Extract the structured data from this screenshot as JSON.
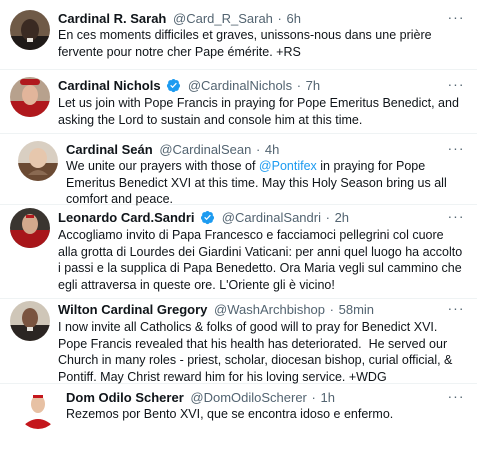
{
  "tweets": [
    {
      "name": "Cardinal R. Sarah",
      "handle": "@Card_R_Sarah",
      "dot": "·",
      "time": "6h",
      "verified": false,
      "text": "En ces moments difficiles et graves, unissons-nous dans une prière fervente pour notre cher Pape émérite. +RS"
    },
    {
      "name": "Cardinal Nichols",
      "handle": "@CardinalNichols",
      "dot": "·",
      "time": "7h",
      "verified": true,
      "text": "Let us join with Pope Francis in praying for Pope Emeritus Benedict, and asking the Lord to sustain and console him at this time."
    },
    {
      "name": "Cardinal Seán",
      "handle": "@CardinalSean",
      "dot": "·",
      "time": "4h",
      "verified": false,
      "text_before": "We unite our prayers with those of ",
      "mention": "@Pontifex",
      "text_after": " in praying for Pope Emeritus Benedict XVI at this time. May this Holy Season bring us all comfort and peace."
    },
    {
      "name": "Leonardo Card.Sandri",
      "handle": "@CardinalSandri",
      "dot": "·",
      "time": "2h",
      "verified": true,
      "text": "Accogliamo invito di Papa Francesco e facciamoci pellegrini col cuore alla grotta di Lourdes dei Giardini Vaticani: per anni quel luogo ha accolto i passi e la supplica di Papa Benedetto. Ora Maria vegli sul cammino che egli attraversa in queste ore. L'Oriente gli è vicino!"
    },
    {
      "name": "Wilton Cardinal Gregory",
      "handle": "@WashArchbishop",
      "dot": "·",
      "time": "58min",
      "verified": false,
      "text": "I now invite all Catholics & folks of good will to pray for Benedict XVI. Pope Francis revealed that his health has deteriorated.  He served our Church in many roles - priest, scholar, diocesan bishop, curial official, & Pontiff. May Christ reward him for his loving service. +WDG"
    },
    {
      "name": "Dom Odilo Scherer",
      "handle": "@DomOdiloScherer",
      "dot": "·",
      "time": "1h",
      "verified": false,
      "text": "Rezemos por Bento XVI, que se encontra idoso e enfermo."
    }
  ],
  "more_glyph": "···",
  "colors": {
    "text": "#0f1419",
    "secondary": "#536471",
    "link": "#1d9bf0",
    "verified": "#1d9bf0",
    "divider": "#eff3f4"
  },
  "icons": {
    "verified": "verified-badge-icon",
    "more": "more-options-icon"
  }
}
